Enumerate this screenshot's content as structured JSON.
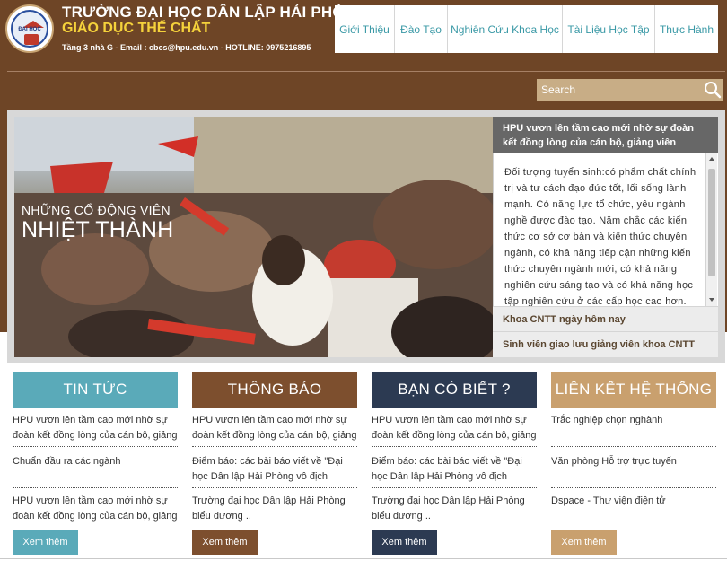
{
  "header": {
    "school_name": "TRƯỜNG ĐẠI HỌC DÂN LẬP HẢI PHÒNG",
    "department": "GIÁO DỤC THỂ CHẤT",
    "contact": "Tầng 3 nhà G - Email : cbcs@hpu.edu.vn - HOTLINE: 0975216895",
    "logo_text": "ĐẠI HỌC"
  },
  "nav": {
    "items": [
      {
        "label": "Giới Thiệu"
      },
      {
        "label": "Đào Tạo"
      },
      {
        "label": "Nghiên Cứu Khoa Học"
      },
      {
        "label": "Tài Liệu Học Tập"
      },
      {
        "label": "Thực Hành"
      }
    ]
  },
  "search": {
    "placeholder": "Search",
    "icon": "search-icon"
  },
  "slider": {
    "caption_line1": "NHỮNG CỔ ĐỘNG VIÊN",
    "caption_line2": "NHIỆT THÀNH",
    "active_title": "HPU vươn lên tầm cao mới nhờ sự đoàn kết đồng lòng của cán bộ, giảng viên",
    "active_text": "Đối tượng tuyển sinh:có phẩm chất chính trị và tư cách đạo đức tốt, lối sống lành mạnh. Có năng lực tổ chức, yêu ngành nghề được đào tạo. Nắm chắc các kiến thức cơ sở cơ bản và kiến thức chuyên ngành, có khả năng tiếp cận những kiến thức chuyên ngành mới, có khả năng nghiên cứu sáng tạo và có khả năng học tập nghiên cứu ở các cấp học cao hơn.",
    "items": [
      {
        "label": "Khoa CNTT ngày hôm nay"
      },
      {
        "label": "Sinh viên giao lưu giảng viên khoa CNTT"
      }
    ]
  },
  "columns": [
    {
      "title": "TIN TỨC",
      "color": "#5aaab9",
      "items": [
        "HPU vươn lên tầm cao mới nhờ sự đoàn kết đồng lòng của cán bộ, giảng",
        "Chuẩn đầu ra các ngành",
        "HPU vươn lên tầm cao mới nhờ sự đoàn kết đồng lòng của cán bộ, giảng"
      ],
      "more_label": "Xem thêm"
    },
    {
      "title": "THÔNG BÁO",
      "color": "#7d4f2e",
      "items": [
        "HPU vươn lên tầm cao mới nhờ sự đoàn kết đồng lòng của cán bộ, giảng",
        "Điểm báo: các bài báo viết về \"Đại học Dân lập Hải Phòng vô địch",
        "Trường đại học Dân lập Hải Phòng biểu dương .."
      ],
      "more_label": "Xem thêm"
    },
    {
      "title": "BẠN CÓ BIẾT ?",
      "color": "#2c3a52",
      "items": [
        "HPU vươn lên tầm cao mới nhờ sự đoàn kết đồng lòng của cán bộ, giảng",
        "Điểm báo: các bài báo viết về \"Đại học Dân lập Hải Phòng vô địch",
        "Trường đại học Dân lập Hải Phòng biểu dương .."
      ],
      "more_label": "Xem thêm"
    },
    {
      "title": "LIÊN KẾT HỆ THỐNG",
      "color": "#c9a06e",
      "items": [
        "Trắc nghiệp chọn nghành",
        "Văn phòng Hỗ trợ trực tuyến",
        "Dspace - Thư viện điện tử"
      ],
      "more_label": "Xem thêm"
    }
  ]
}
